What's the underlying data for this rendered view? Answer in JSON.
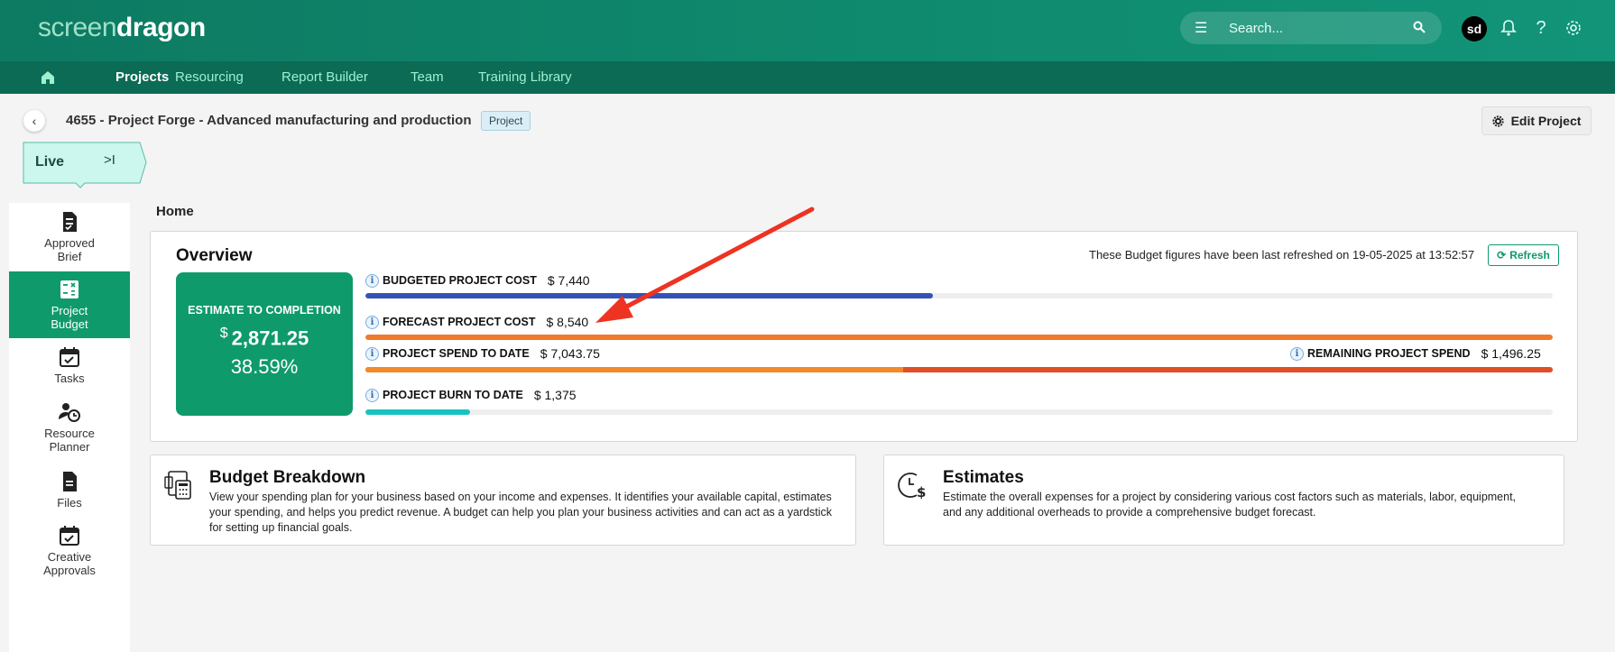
{
  "header": {
    "logo_part1": "screen",
    "logo_part2": "dragon",
    "search_placeholder": "Search...",
    "avatar_initials": "sd"
  },
  "nav": {
    "items": [
      "Projects",
      "Resourcing",
      "Report Builder",
      "Team",
      "Training Library"
    ],
    "active": "Projects"
  },
  "project": {
    "title": "4655 - Project Forge - Advanced manufacturing and production",
    "type_tag": "Project",
    "edit_label": "Edit Project",
    "status": "Live",
    "collapse_glyph": ">I"
  },
  "sidebar": {
    "items": [
      {
        "label_line1": "Approved",
        "label_line2": "Brief",
        "icon": "document-icon"
      },
      {
        "label_line1": "Project",
        "label_line2": "Budget",
        "icon": "calculator-icon"
      },
      {
        "label_line1": "Tasks",
        "label_line2": "",
        "icon": "calendar-check-icon"
      },
      {
        "label_line1": "Resource",
        "label_line2": "Planner",
        "icon": "person-clock-icon"
      },
      {
        "label_line1": "Files",
        "label_line2": "",
        "icon": "file-icon"
      },
      {
        "label_line1": "Creative",
        "label_line2": "Approvals",
        "icon": "calendar-check-icon"
      }
    ],
    "active_index": 1
  },
  "breadcrumb": "Home",
  "overview": {
    "title": "Overview",
    "refresh_note": "These Budget figures have been last refreshed on 19-05-2025 at 13:52:57",
    "refresh_label": "Refresh",
    "estimate": {
      "label": "ESTIMATE TO COMPLETION",
      "currency": "$",
      "amount": "2,871.25",
      "percent": "38.59%"
    },
    "metrics": {
      "budgeted": {
        "label": "BUDGETED PROJECT COST",
        "value": "$ 7,440"
      },
      "forecast": {
        "label": "FORECAST PROJECT COST",
        "value": "$ 8,540"
      },
      "spend": {
        "label": "PROJECT SPEND TO DATE",
        "value": "$ 7,043.75"
      },
      "remaining": {
        "label": "REMAINING PROJECT SPEND",
        "value": "$ 1,496.25"
      },
      "burn": {
        "label": "PROJECT BURN TO DATE",
        "value": "$ 1,375"
      }
    },
    "bar_fractions": {
      "budgeted": 0.478,
      "forecast": 1.0,
      "spend": 0.453,
      "burn": 0.088
    },
    "colors": {
      "budgeted": "#3553b5",
      "forecast": "#f07a2b",
      "spend": "#f28a2a",
      "remaining": "#e04e27",
      "burn": "#19c2bf",
      "accent": "#0f9a6c"
    }
  },
  "cards": {
    "budget": {
      "title": "Budget Breakdown",
      "desc": "View your spending plan for your business based on your income and expenses. It identifies your available capital, estimates your spending, and helps you predict revenue. A budget can help you plan your business activities and can act as a yardstick for setting up financial goals."
    },
    "estimates": {
      "title": "Estimates",
      "desc": "Estimate the overall expenses for a project by considering various cost factors such as materials, labor, equipment, and any additional overheads to provide a comprehensive budget forecast."
    }
  }
}
